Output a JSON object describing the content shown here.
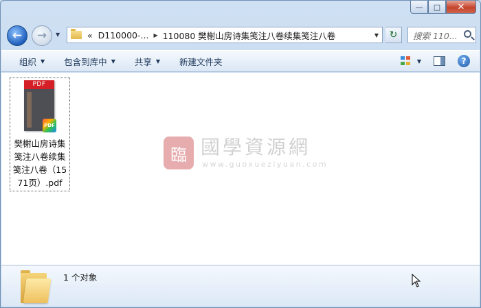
{
  "window": {
    "caption_buttons": {
      "minimize": "—",
      "maximize": "□",
      "close": "✕"
    }
  },
  "nav": {
    "back_glyph": "←",
    "forward_glyph": "→",
    "address": {
      "crumbs": [
        "«",
        "D110000-...",
        "110080 樊榭山房诗集笺注八卷续集笺注八卷"
      ]
    },
    "refresh_glyph": "↻",
    "search": {
      "placeholder": "搜索 110..."
    }
  },
  "toolbar": {
    "organize": "组织",
    "include_in_library": "包含到库中",
    "share": "共享",
    "new_folder": "新建文件夹",
    "help": "?"
  },
  "content": {
    "files": [
      {
        "icon": "pdf-file-icon",
        "band_text": "PDF",
        "badge_text": "PDF",
        "label": "樊榭山房诗集笺注八卷续集笺注八卷（1571页）.pdf"
      }
    ],
    "watermark": {
      "seal": "臨",
      "title": "國學資源網",
      "url": "www.guoxueziyuan.com"
    }
  },
  "details": {
    "count_text": "1 个对象"
  },
  "colors": {
    "accent": "#1f5fbd",
    "pdf_red": "#d31f25",
    "folder_yellow": "#eec05d"
  }
}
